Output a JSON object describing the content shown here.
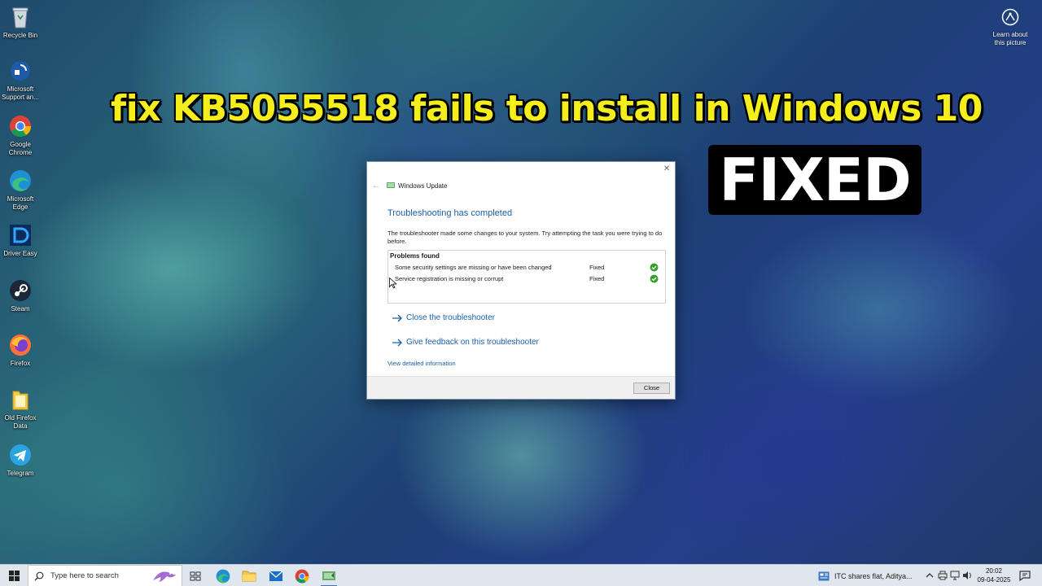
{
  "desktop": {
    "icons": [
      {
        "label": "Recycle Bin",
        "icon": "recycle-bin-icon"
      },
      {
        "label": "Microsoft Support an...",
        "icon": "microsoft-support-icon"
      },
      {
        "label": "Google Chrome",
        "icon": "chrome-icon"
      },
      {
        "label": "Microsoft Edge",
        "icon": "edge-icon"
      },
      {
        "label": "Driver Easy",
        "icon": "driver-easy-icon"
      },
      {
        "label": "Steam",
        "icon": "steam-icon"
      },
      {
        "label": "Firefox",
        "icon": "firefox-icon"
      },
      {
        "label": "Old Firefox Data",
        "icon": "folder-icon"
      },
      {
        "label": "Telegram",
        "icon": "telegram-icon"
      }
    ],
    "learn_picture": "Learn about this picture"
  },
  "overlay": {
    "headline": "fix KB5055518 fails to install in Windows 10",
    "stamp": "FIXED",
    "headline_color": "#f3ee1c"
  },
  "dialog": {
    "title": "Windows Update",
    "heading": "Troubleshooting has completed",
    "description": "The troubleshooter made some changes to your system. Try attempting the task you were trying to do before.",
    "problems_header": "Problems found",
    "problems": [
      {
        "text": "Some security settings are missing or have been changed",
        "status": "Fixed"
      },
      {
        "text": "Service registration is missing or corrupt",
        "status": "Fixed"
      }
    ],
    "links": [
      "Close the troubleshooter",
      "Give feedback on this troubleshooter"
    ],
    "detail_link": "View detailed information",
    "close_button": "Close",
    "accent_color": "#1a5fa8"
  },
  "taskbar": {
    "search_placeholder": "Type here to search",
    "apps": [
      "task-view-icon",
      "edge-icon",
      "file-explorer-icon",
      "mail-icon",
      "chrome-icon",
      "windows-update-icon"
    ],
    "news": "ITC shares flat, Aditya...",
    "time": "20:02",
    "date": "09-04-2025"
  }
}
